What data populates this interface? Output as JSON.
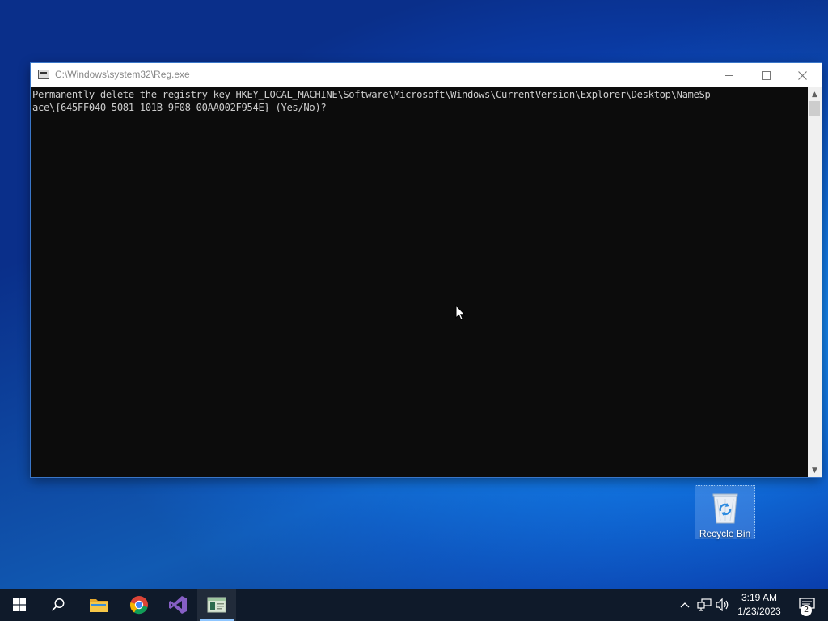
{
  "window": {
    "title": "C:\\Windows\\system32\\Reg.exe",
    "console_lines": [
      "Permanently delete the registry key HKEY_LOCAL_MACHINE\\Software\\Microsoft\\Windows\\CurrentVersion\\Explorer\\Desktop\\NameSp",
      "ace\\{645FF040-5081-101B-9F08-00AA002F954E} (Yes/No)?"
    ]
  },
  "desktop": {
    "recycle_bin_label": "Recycle Bin"
  },
  "taskbar": {
    "pinned": [
      "windows-start",
      "search",
      "file-explorer",
      "chrome",
      "visual-studio",
      "reg-console"
    ],
    "clock_time": "3:19 AM",
    "clock_date": "1/23/2023",
    "notification_count": "2"
  },
  "colors": {
    "console_bg": "#0c0c0c",
    "console_text": "#cccccc",
    "taskbar_bg": "#0f1a2a",
    "desktop_accent": "#0d63d6"
  }
}
